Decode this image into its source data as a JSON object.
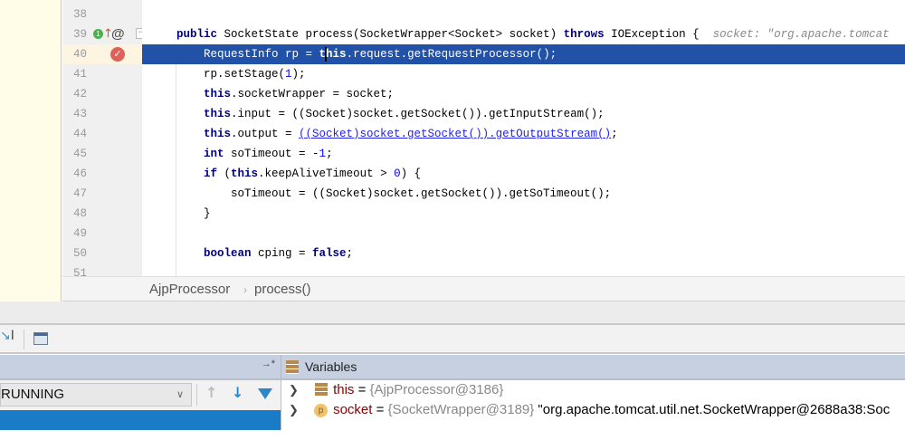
{
  "gutter": {
    "line_numbers": [
      "38",
      "39",
      "40",
      "41",
      "42",
      "43",
      "44",
      "45",
      "46",
      "47",
      "48",
      "49",
      "50",
      "51"
    ],
    "override_badge": "1",
    "annotation_icon": "@"
  },
  "code": {
    "l39": {
      "kw1": "public",
      "t1": " SocketState process(SocketWrapper<Socket> socket) ",
      "kw2": "throws",
      "t2": " IOException {",
      "hint": "socket: \"org.apache.tomcat"
    },
    "l40": {
      "t1": "RequestInfo rp = ",
      "kw1a": "t",
      "kw1b": "his",
      "t2": ".request.getRequestProcessor();"
    },
    "l41": {
      "t1": "rp.setStage(",
      "n": "1",
      "t2": ");"
    },
    "l42": {
      "kw": "this",
      "t": ".socketWrapper = socket;"
    },
    "l43": {
      "kw": "this",
      "t": ".input = ((Socket)socket.getSocket()).getInputStream();"
    },
    "l44": {
      "kw": "this",
      "t1": ".output = ",
      "link": "((Socket)socket.getSocket()).getOutputStream()",
      "t2": ";"
    },
    "l45": {
      "kw": "int",
      "t1": " soTimeout = -",
      "n": "1",
      "t2": ";"
    },
    "l46": {
      "kw1": "if",
      "t1": " (",
      "kw2": "this",
      "t2": ".keepAliveTimeout > ",
      "n": "0",
      "t3": ") {"
    },
    "l47": {
      "t": "soTimeout = ((Socket)socket.getSocket()).getSoTimeout();"
    },
    "l48": {
      "t": "}"
    },
    "l50": {
      "kw1": "boolean",
      "t1": " cping = ",
      "kw2": "false",
      "t2": ";"
    }
  },
  "breadcrumb": {
    "class": "AjpProcessor",
    "sep": "›",
    "method": "process()"
  },
  "debugger": {
    "thread_state": "RUNNING",
    "pin_label": "→*",
    "variables_title": "Variables",
    "variables": [
      {
        "name": "this",
        "eq": " = ",
        "type": "{AjpProcessor@3186}",
        "value": ""
      },
      {
        "name": "socket",
        "eq": " = ",
        "type": "{SocketWrapper@3189}",
        "value": " \"org.apache.tomcat.util.net.SocketWrapper@2688a38:Soc"
      }
    ],
    "param_badge": "p"
  },
  "colors": {
    "selection": "#2152a8",
    "keyword": "#000080",
    "frame_selected": "#1a7bc6"
  }
}
